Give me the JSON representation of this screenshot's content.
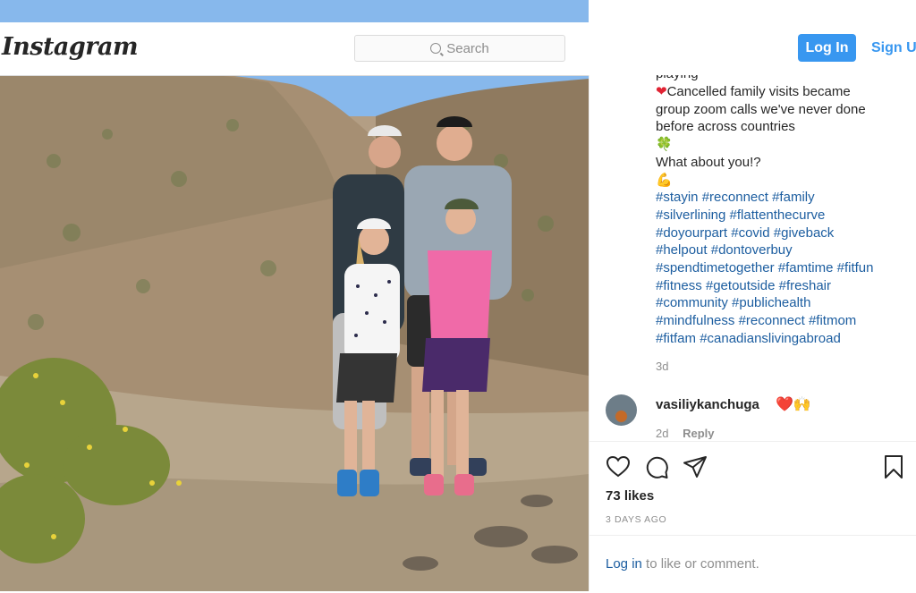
{
  "nav": {
    "logo": "Instagram",
    "search_placeholder": "Search",
    "login_label": "Log In",
    "signup_label": "Sign Up"
  },
  "post": {
    "photo_alt": "Family of four standing on a rocky desert hillside",
    "caption": {
      "cut_line": "playing",
      "line1": "Cancelled family visits became",
      "line2": "group zoom calls we've never done",
      "line3": "before across countries",
      "line4": "What about you!?",
      "hashtags": [
        [
          "#stayin",
          "#reconnect",
          "#family"
        ],
        [
          "#silverlining",
          "#flattenthecurve"
        ],
        [
          "#doyourpart",
          "#covid",
          "#giveback"
        ],
        [
          "#helpout",
          "#dontoverbuy"
        ],
        [
          "#spendtimetogether",
          "#famtime",
          "#fitfun"
        ],
        [
          "#fitness",
          "#getoutside",
          "#freshair"
        ],
        [
          "#community",
          "#publichealth"
        ],
        [
          "#mindfulness",
          "#reconnect",
          "#fitmom"
        ],
        [
          "#fitfam",
          "#canadianslivingabroad"
        ]
      ],
      "emoji_heart": "❤",
      "emoji_clover": "🍀",
      "emoji_flex": "💪"
    },
    "age": "3d",
    "comment": {
      "username": "vasiliykanchuga",
      "emoji": "❤️🙌",
      "age": "2d",
      "reply_label": "Reply"
    },
    "likes": "73 likes",
    "date": "3 DAYS AGO",
    "login_link": "Log in",
    "login_suffix": " to like or comment."
  }
}
